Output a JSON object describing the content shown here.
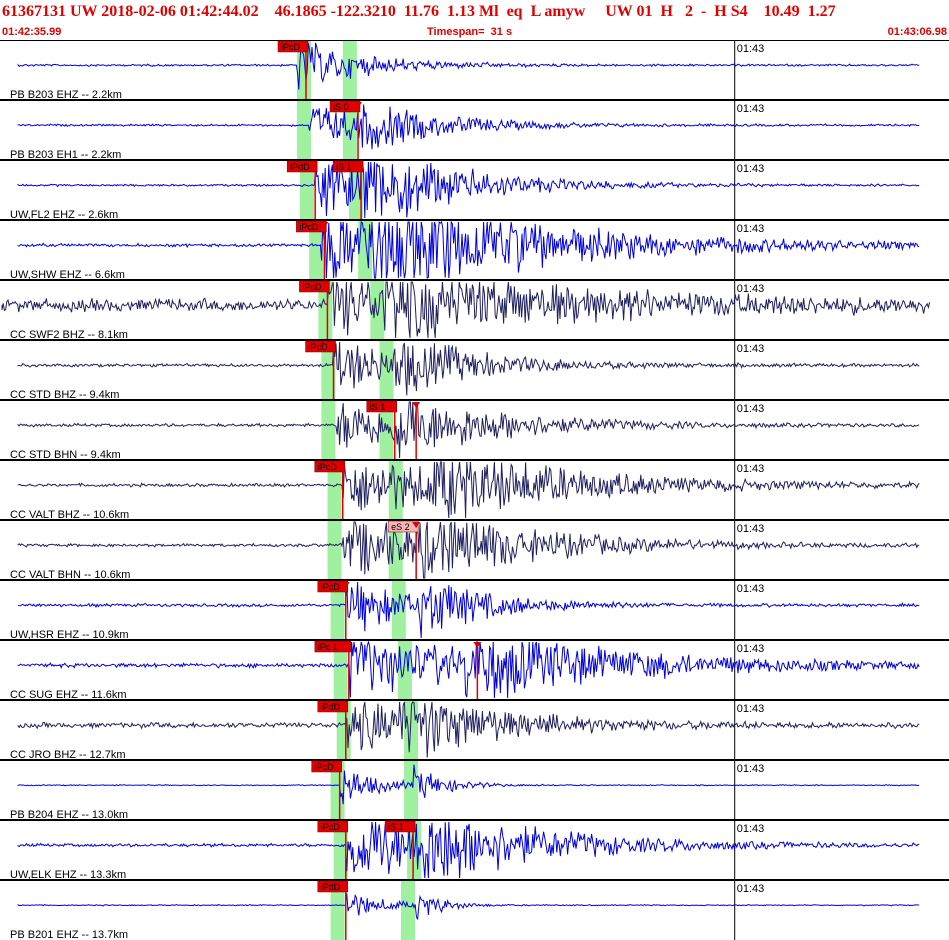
{
  "header": {
    "event_line": "61367131 UW 2018-02-06 01:42:44.02    46.1865 -122.3210  11.76  1.13 Ml  eq  L amyw     UW 01  H   2  -  H S4    10.49  1.27",
    "start_time": "01:42:35.99",
    "timespan": "Timespan=  31 s",
    "end_time": "01:43:06.98"
  },
  "colors": {
    "header_text": "#e00000",
    "trace_blue": "#0000dd",
    "trace_navy": "#202060",
    "p_band": "#9ff09f",
    "s_band": "#9ff09f",
    "pick_box": "#e00000",
    "pick_box_light": "#f5b5b5",
    "pick_line": "#e00000",
    "panel_border": "#000000"
  },
  "chart_data": {
    "type": "line",
    "title": "61367131 UW 2018-02-06 01:42:44.02",
    "x_range_seconds": [
      0,
      31
    ],
    "time_mark_label": "01:43",
    "time_mark_second": 24.01,
    "traces": [
      {
        "label": "PB B203 EHZ -- 2.2km",
        "color": "trace_blue",
        "amp": 0.55,
        "noise": 0.02,
        "onset": 9.7,
        "p_band": 9.9,
        "s_band": 11.4,
        "picks": [
          {
            "label": "iPcD",
            "t": 10.0,
            "light": false,
            "tri": false
          }
        ],
        "decay": 2.2,
        "ss": 0
      },
      {
        "label": "PB B203 EH1 -- 2.2km",
        "color": "trace_blue",
        "amp": 0.45,
        "noise": 0.02,
        "onset": 10.1,
        "p_band": 9.9,
        "s_band": 11.4,
        "picks": [
          {
            "label": "iS 0",
            "t": 11.7,
            "light": false,
            "tri": true
          }
        ],
        "decay": 2.8,
        "ss": 11.7
      },
      {
        "label": "UW,FL2 EHZ -- 2.6km",
        "color": "trace_blue",
        "amp": 0.75,
        "noise": 0.02,
        "onset": 10.3,
        "p_band": 10.0,
        "s_band": 11.6,
        "picks": [
          {
            "label": "iPdD",
            "t": 10.3,
            "light": false,
            "tri": false
          },
          {
            "label": "iS 1",
            "t": 11.8,
            "light": false,
            "tri": false
          }
        ],
        "decay": 3.2,
        "ss": 11.8
      },
      {
        "label": "UW,SHW EHZ -- 6.6km",
        "color": "trace_blue",
        "amp": 0.8,
        "noise": 0.03,
        "onset": 10.5,
        "p_band": 10.3,
        "s_band": 11.9,
        "picks": [
          {
            "label": "iPcD",
            "t": 10.6,
            "light": false,
            "tri": true
          }
        ],
        "decay": 6.0,
        "ss": 12.0
      },
      {
        "label": "CC SWF2 BHZ -- 8.1km",
        "color": "trace_navy",
        "amp": 0.55,
        "noise": 0.12,
        "onset": 10.7,
        "p_band": 10.6,
        "s_band": 12.3,
        "picks": [
          {
            "label": "iPcD",
            "t": 10.7,
            "light": false,
            "tri": false
          }
        ],
        "decay": 6.5,
        "ss": 12.5
      },
      {
        "label": "CC STD BHZ -- 9.4km",
        "color": "trace_navy",
        "amp": 0.55,
        "noise": 0.03,
        "onset": 10.9,
        "p_band": 10.7,
        "s_band": 12.6,
        "picks": [
          {
            "label": "iPcD",
            "t": 10.9,
            "light": false,
            "tri": false
          }
        ],
        "decay": 3.0,
        "ss": 12.9
      },
      {
        "label": "CC STD BHN -- 9.4km",
        "color": "trace_navy",
        "amp": 0.6,
        "noise": 0.03,
        "onset": 11.0,
        "p_band": 10.7,
        "s_band": 12.6,
        "picks": [
          {
            "label": "iS 1",
            "t": 12.9,
            "light": false,
            "tri": false
          },
          {
            "label": "",
            "t": 13.6,
            "light": false,
            "tri": true
          }
        ],
        "decay": 3.5,
        "ss": 12.9
      },
      {
        "label": "CC VALT BHZ -- 10.6km",
        "color": "trace_navy",
        "amp": 0.65,
        "noise": 0.03,
        "onset": 11.2,
        "p_band": 10.9,
        "s_band": 12.9,
        "picks": [
          {
            "label": "iPcD",
            "t": 11.2,
            "light": false,
            "tri": false
          }
        ],
        "decay": 5.0,
        "ss": 14.0
      },
      {
        "label": "CC VALT BHN -- 10.6km",
        "color": "trace_navy",
        "amp": 0.7,
        "noise": 0.03,
        "onset": 11.2,
        "p_band": 10.9,
        "s_band": 12.9,
        "picks": [
          {
            "label": "eS 2",
            "t": 13.6,
            "light": true,
            "tri": true
          }
        ],
        "decay": 4.0,
        "ss": 13.6
      },
      {
        "label": "UW,HSR EHZ -- 10.9km",
        "color": "trace_blue",
        "amp": 0.6,
        "noise": 0.03,
        "onset": 11.3,
        "p_band": 11.0,
        "s_band": 13.0,
        "picks": [
          {
            "label": "iPcD",
            "t": 11.3,
            "light": false,
            "tri": true
          }
        ],
        "decay": 2.5,
        "ss": 13.7
      },
      {
        "label": "CC SUG EHZ -- 11.6km",
        "color": "trace_blue",
        "amp": 0.65,
        "noise": 0.04,
        "onset": 11.4,
        "p_band": 11.1,
        "s_band": 13.2,
        "picks": [
          {
            "label": "iPc 1",
            "t": 11.4,
            "light": false,
            "tri": false
          },
          {
            "label": "",
            "t": 15.6,
            "light": false,
            "tri": true
          }
        ],
        "decay": 5.5,
        "ss": 15.2
      },
      {
        "label": "CC JRO BHZ -- 12.7km",
        "color": "trace_navy",
        "amp": 0.6,
        "noise": 0.05,
        "onset": 11.3,
        "p_band": 11.2,
        "s_band": 13.4,
        "picks": [
          {
            "label": "iPdD",
            "t": 11.3,
            "light": false,
            "tri": false
          }
        ],
        "decay": 3.5,
        "ss": 13.0
      },
      {
        "label": "PB B204 EHZ -- 13.0km",
        "color": "trace_blue",
        "amp": 0.45,
        "noise": 0.01,
        "onset": 11.1,
        "p_band": 11.0,
        "s_band": 13.4,
        "picks": [
          {
            "label": "iPcD",
            "t": 11.1,
            "light": false,
            "tri": false
          }
        ],
        "decay": 1.2,
        "ss": 13.5
      },
      {
        "label": "UW,ELK EHZ -- 13.3km",
        "color": "trace_blue",
        "amp": 0.8,
        "noise": 0.03,
        "onset": 11.3,
        "p_band": 11.1,
        "s_band": 13.5,
        "picks": [
          {
            "label": "iPcD",
            "t": 11.3,
            "light": false,
            "tri": false
          },
          {
            "label": "iS 1",
            "t": 13.5,
            "light": false,
            "tri": false
          }
        ],
        "decay": 4.0,
        "ss": 13.6
      },
      {
        "label": "PB B201 EHZ -- 13.7km",
        "color": "trace_blue",
        "amp": 0.4,
        "noise": 0.01,
        "onset": 11.3,
        "p_band": 11.0,
        "s_band": 13.3,
        "picks": [
          {
            "label": "iPdD",
            "t": 11.3,
            "light": false,
            "tri": false
          }
        ],
        "decay": 1.0,
        "ss": 13.6
      }
    ]
  }
}
